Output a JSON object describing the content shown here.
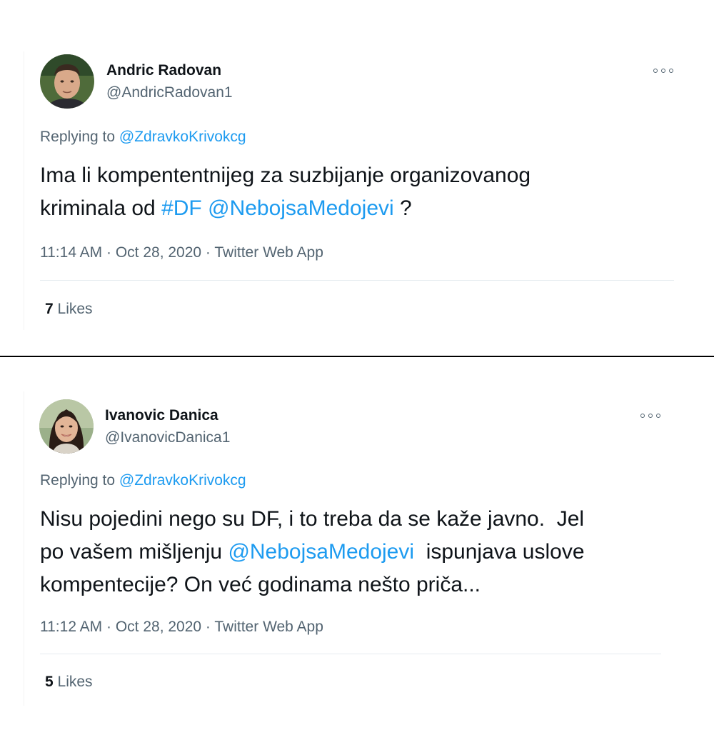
{
  "tweets": [
    {
      "author_name": "Andric Radovan",
      "author_handle": "@AndricRadovan1",
      "avatar_icon": "avatar-man-photo",
      "more_icon": "more-options-icon",
      "replying_prefix": "Replying to",
      "replying_handle": "@ZdravkoKrivokcg",
      "text_line1": "Ima li kompententnijeg za suzbijanje organizovanog",
      "text_line2_a": "kriminala od ",
      "text_hashtag": "#DF",
      "text_mention": "@NebojsaMedojevi",
      "text_line2_b": " ?",
      "time": "11:14 AM",
      "date": "Oct 28, 2020",
      "source": "Twitter Web App",
      "likes_count": "7",
      "likes_label": "Likes"
    },
    {
      "author_name": "Ivanovic Danica",
      "author_handle": "@IvanovicDanica1",
      "avatar_icon": "avatar-woman-photo",
      "more_icon": "more-options-icon",
      "replying_prefix": "Replying to",
      "replying_handle": "@ZdravkoKrivokcg",
      "text_line1": "Nisu pojedini nego su DF, i to treba da se kaže javno.  Jel",
      "text_line2_a": "po vašem mišljenju ",
      "text_mention": "@NebojsaMedojevi",
      "text_line2_b": "  ispunjava uslove",
      "text_line3": "kompentecije? On već godinama nešto priča...",
      "time": "11:12 AM",
      "date": "Oct 28, 2020",
      "source": "Twitter Web App",
      "likes_count": "5",
      "likes_label": "Likes"
    }
  ],
  "separator": " · ",
  "colors": {
    "link": "#1d9bf0",
    "secondary": "#536471",
    "text": "#0f1419",
    "divider": "#000000"
  }
}
